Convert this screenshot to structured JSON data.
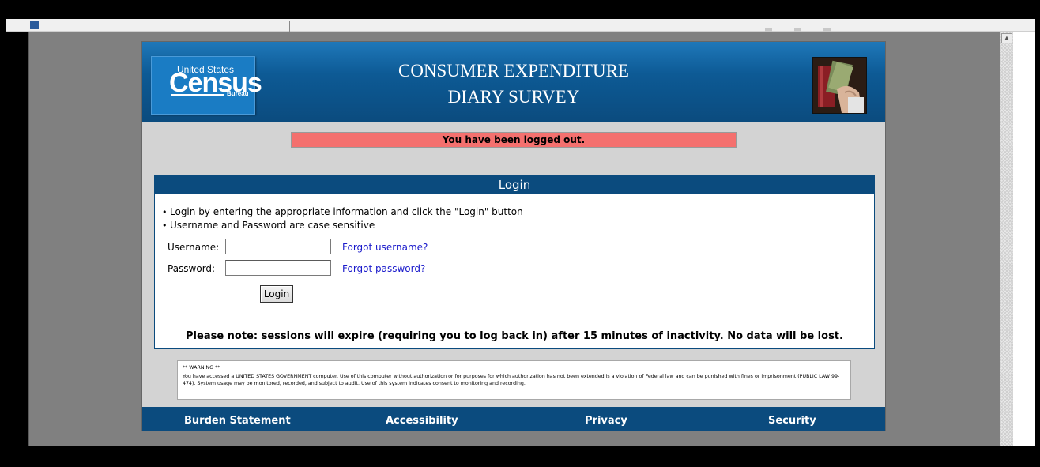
{
  "header": {
    "logo_top": "United States",
    "logo_main": "Census",
    "logo_sub": "Bureau",
    "title_line1": "CONSUMER EXPENDITURE",
    "title_line2": "DIARY SURVEY"
  },
  "banner": {
    "message": "You have been logged out."
  },
  "login": {
    "heading": "Login",
    "instructions": [
      "Login by entering the appropriate information and click the \"Login\" button",
      "Username and Password are case sensitive"
    ],
    "username_label": "Username:",
    "username_value": "",
    "password_label": "Password:",
    "password_value": "",
    "forgot_username": "Forgot username?",
    "forgot_password": "Forgot password?",
    "button_label": "Login",
    "session_note": "Please note: sessions will expire (requiring you to log back in) after 15 minutes of inactivity. No data will be lost."
  },
  "warning": {
    "title": "** WARNING **",
    "text": "You have accessed a UNITED STATES GOVERNMENT computer. Use of this computer without authorization or for purposes for which authorization has not been extended is a violation of Federal law and can be punished with fines or imprisonment (PUBLIC LAW 99-474). System usage may be monitored, recorded, and subject to audit. Use of this system indicates consent to monitoring and recording."
  },
  "footer": {
    "links": [
      "Burden Statement",
      "Accessibility",
      "Privacy",
      "Security"
    ]
  },
  "colors": {
    "header_blue": "#0b4b7e",
    "banner_red": "#f4706e",
    "link_blue": "#1a1acb",
    "page_gray": "#d3d3d3"
  },
  "icons": {
    "scroll_up": "scroll-up-arrow-icon",
    "page_icon": "page-icon"
  }
}
